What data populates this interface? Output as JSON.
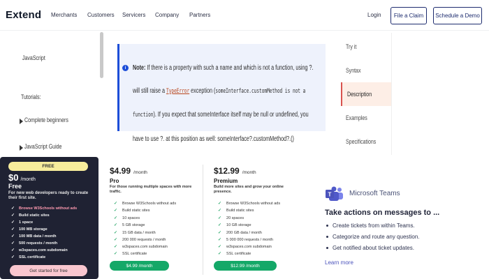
{
  "nav": {
    "logo": "Extend",
    "links": [
      "Merchants",
      "Customers",
      "Servicers",
      "Company",
      "Partners"
    ],
    "login": "Login",
    "file_claim": "File a Claim",
    "schedule_demo": "Schedule a Demo"
  },
  "doc_sidebar": {
    "javascript": "JavaScript",
    "tutorials": "Tutorials:",
    "items": [
      "Complete beginners",
      "JavaScript Guide"
    ]
  },
  "note": {
    "icon": "info-icon",
    "label": "Note:",
    "line1": " If there is a property with such a name and which is not a function, using ?.",
    "line2_pre": "will still raise a ",
    "line2_code_link": "TypeError",
    "line2_mid": " exception (",
    "line2_code": "someInterface.customMethod is not a",
    "line3_code": "function",
    "line3_post": "). If you expect that someInterface itself may be null or undefined, you",
    "line4": "have to use ?. at this position as well: someInterface?.customMethod?.()"
  },
  "toc": {
    "items": [
      "Try it",
      "Syntax",
      "Description",
      "Examples",
      "Specifications"
    ],
    "active_index": 2
  },
  "free_plan": {
    "pill": "FREE",
    "price": "$0",
    "per": "/month",
    "name": "Free",
    "desc": "For new web developers ready to create their first site.",
    "features": [
      "Browse W3Schools without ads",
      "Build static sites",
      "1 space",
      "100 MB storage",
      "100 MB data / month",
      "500 requests / month",
      "w3spaces.com subdomain",
      "SSL certificate"
    ],
    "cta": "Get started for free"
  },
  "pro_plan": {
    "price": "$4.99",
    "per": "/month",
    "name": "Pro",
    "desc": "For those running multiple spaces with more traffic.",
    "features": [
      "Browse W3Schools without ads",
      "Build static sites",
      "10 spaces",
      "5 GB storage",
      "15 GB data / month",
      "200 000 requests / month",
      "w3spaces.com subdomain",
      "SSL certificate"
    ],
    "cta": "$4.99 /month"
  },
  "premium_plan": {
    "price": "$12.99",
    "per": "/month",
    "name": "Premium",
    "desc": "Build more sites and grow your online presence.",
    "features": [
      "Browse W3Schools without ads",
      "Build static sites",
      "20 spaces",
      "10 GB storage",
      "200 GB data / month",
      "5 000 000 requests / month",
      "w3spaces.com subdomain",
      "SSL certificate"
    ],
    "cta": "$12.99 /month"
  },
  "teams_ad": {
    "brand": "Microsoft Teams",
    "headline": "Take actions on messages to ...",
    "bullets": [
      "Create tickets from within Teams.",
      "Categorize and route any question.",
      "Get notified about ticket updates."
    ],
    "link": "Learn more"
  },
  "colors": {
    "accent_navy": "#1c2b6e",
    "note_blue": "#1d4ed8",
    "cta_green": "#14a868",
    "free_bg": "#1f2233",
    "pill_yellow": "#f7ed9c",
    "pill_pink": "#f9c6cf",
    "teams_purple": "#4b53bc"
  }
}
